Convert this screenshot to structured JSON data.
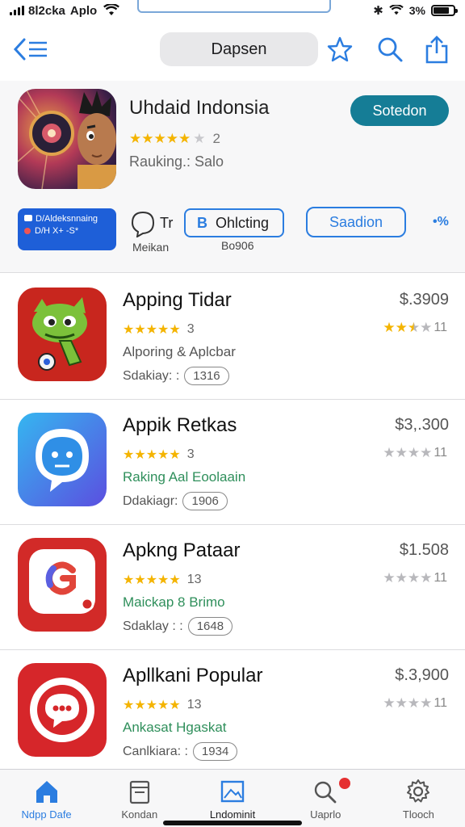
{
  "status_bar": {
    "carrier": "8l2cka",
    "app": "Aplo",
    "battery": "3%"
  },
  "nav": {
    "search_label": "Dapsen",
    "icons": [
      "back-list-icon",
      "star-icon",
      "search-icon",
      "share-icon"
    ]
  },
  "featured": {
    "title": "Uhdaid Indonsia",
    "rating_count": "2",
    "subtitle": "Rauking.: Salo",
    "button": "Sotedon",
    "banner_line1": "D/Aldeksnnaing",
    "banner_line2": "D/H X+ -S*",
    "tag_label": "Tr",
    "tag_caption": "Meikan",
    "chip_letter": "B",
    "chip_label": "Ohlcting",
    "chip_caption": "Bo906",
    "button2": "Saadion",
    "share_mark": "•%"
  },
  "apps": [
    {
      "name": "Apping Tidar",
      "rating_count": "3",
      "subtitle": "Alporing & Aplcbar",
      "subtitle_color": "gray",
      "meta_label": "Sdakiay: :",
      "meta_pill": "1316",
      "price": "$.3909",
      "right_rating_count": "11",
      "right_stars_on": 2.5,
      "icon": "green-creature-icon"
    },
    {
      "name": "Appik Retkas",
      "rating_count": "3",
      "subtitle": "Raking Aal Eoolaain",
      "subtitle_color": "green",
      "meta_label": "Ddakiagr:",
      "meta_pill": "1906",
      "price": "$3,.300",
      "right_rating_count": "11",
      "right_stars_on": 0,
      "icon": "chat-face-icon"
    },
    {
      "name": "Apkng Pataar",
      "rating_count": "13",
      "subtitle": "Maickap 8 Brimo",
      "subtitle_color": "green",
      "meta_label": "Sdaklay : :",
      "meta_pill": "1648",
      "price": "$1.508",
      "right_rating_count": "11",
      "right_stars_on": 0,
      "icon": "message-g-icon"
    },
    {
      "name": "Apllkani Popular",
      "rating_count": "13",
      "subtitle": "Ankasat Hgaskat",
      "subtitle_color": "green",
      "meta_label": "Canlkiara: :",
      "meta_pill": "1934",
      "price": "$.3,900",
      "right_rating_count": "11",
      "right_stars_on": 0,
      "icon": "chat-bubble-icon"
    }
  ],
  "tabs": [
    {
      "label": "Ndpp Dafe",
      "icon": "home-icon",
      "active": true
    },
    {
      "label": "Kondan",
      "icon": "archive-icon",
      "active": false
    },
    {
      "label": "Lndominit",
      "icon": "image-icon",
      "active": false
    },
    {
      "label": "Uaprlo",
      "icon": "search-badge-icon",
      "active": false
    },
    {
      "label": "Tlooch",
      "icon": "gear-icon",
      "active": false
    }
  ],
  "colors": {
    "accent": "#2b7de0",
    "teal_button": "#157d96",
    "star": "#f4b400",
    "green_text": "#2f8f5b"
  }
}
